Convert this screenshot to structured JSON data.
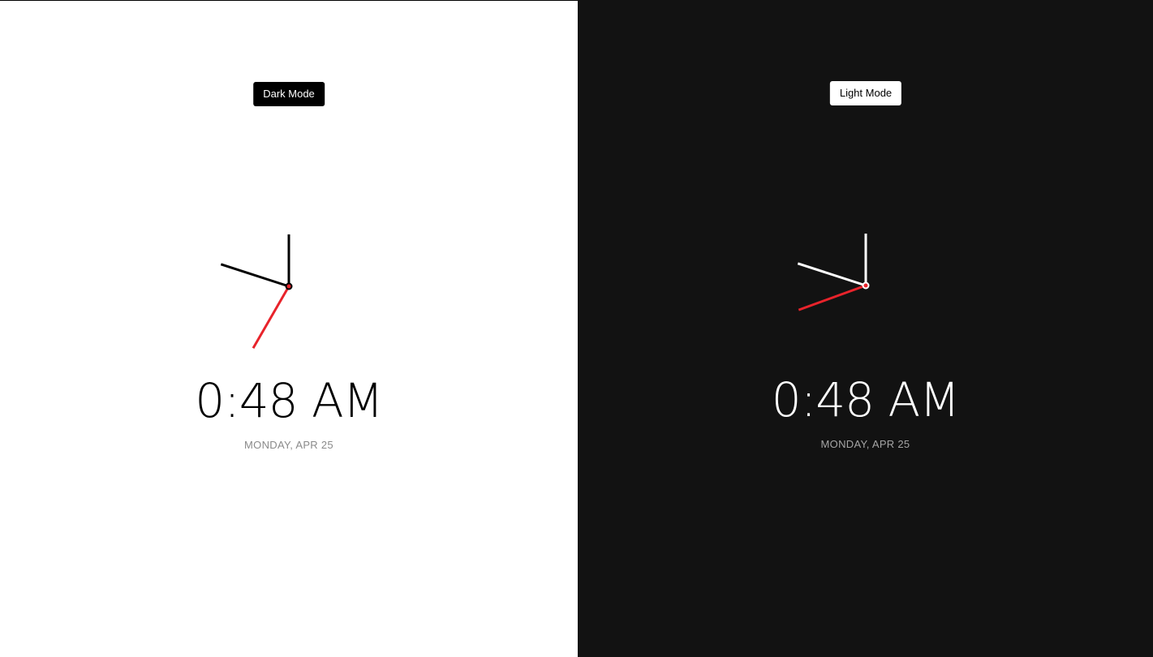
{
  "clock_light": {
    "theme": "light",
    "toggle_label": "Dark Mode",
    "time_display": "0:48 AM",
    "date_display": "MONDAY, APR 25",
    "hand_angles_deg": {
      "hour": 288,
      "minute": 0,
      "second": 210
    },
    "colors": {
      "background": "#ffffff",
      "hands": "#000000",
      "second_hand": "#e8232b",
      "date": "#8a8a8a"
    }
  },
  "clock_dark": {
    "theme": "dark",
    "toggle_label": "Light Mode",
    "time_display": "0:48 AM",
    "date_display": "MONDAY, APR 25",
    "hand_angles_deg": {
      "hour": 288,
      "minute": 0,
      "second": 250
    },
    "colors": {
      "background": "#121212",
      "hands": "#ffffff",
      "second_hand": "#e8232b",
      "date": "#a5a5a5"
    }
  }
}
